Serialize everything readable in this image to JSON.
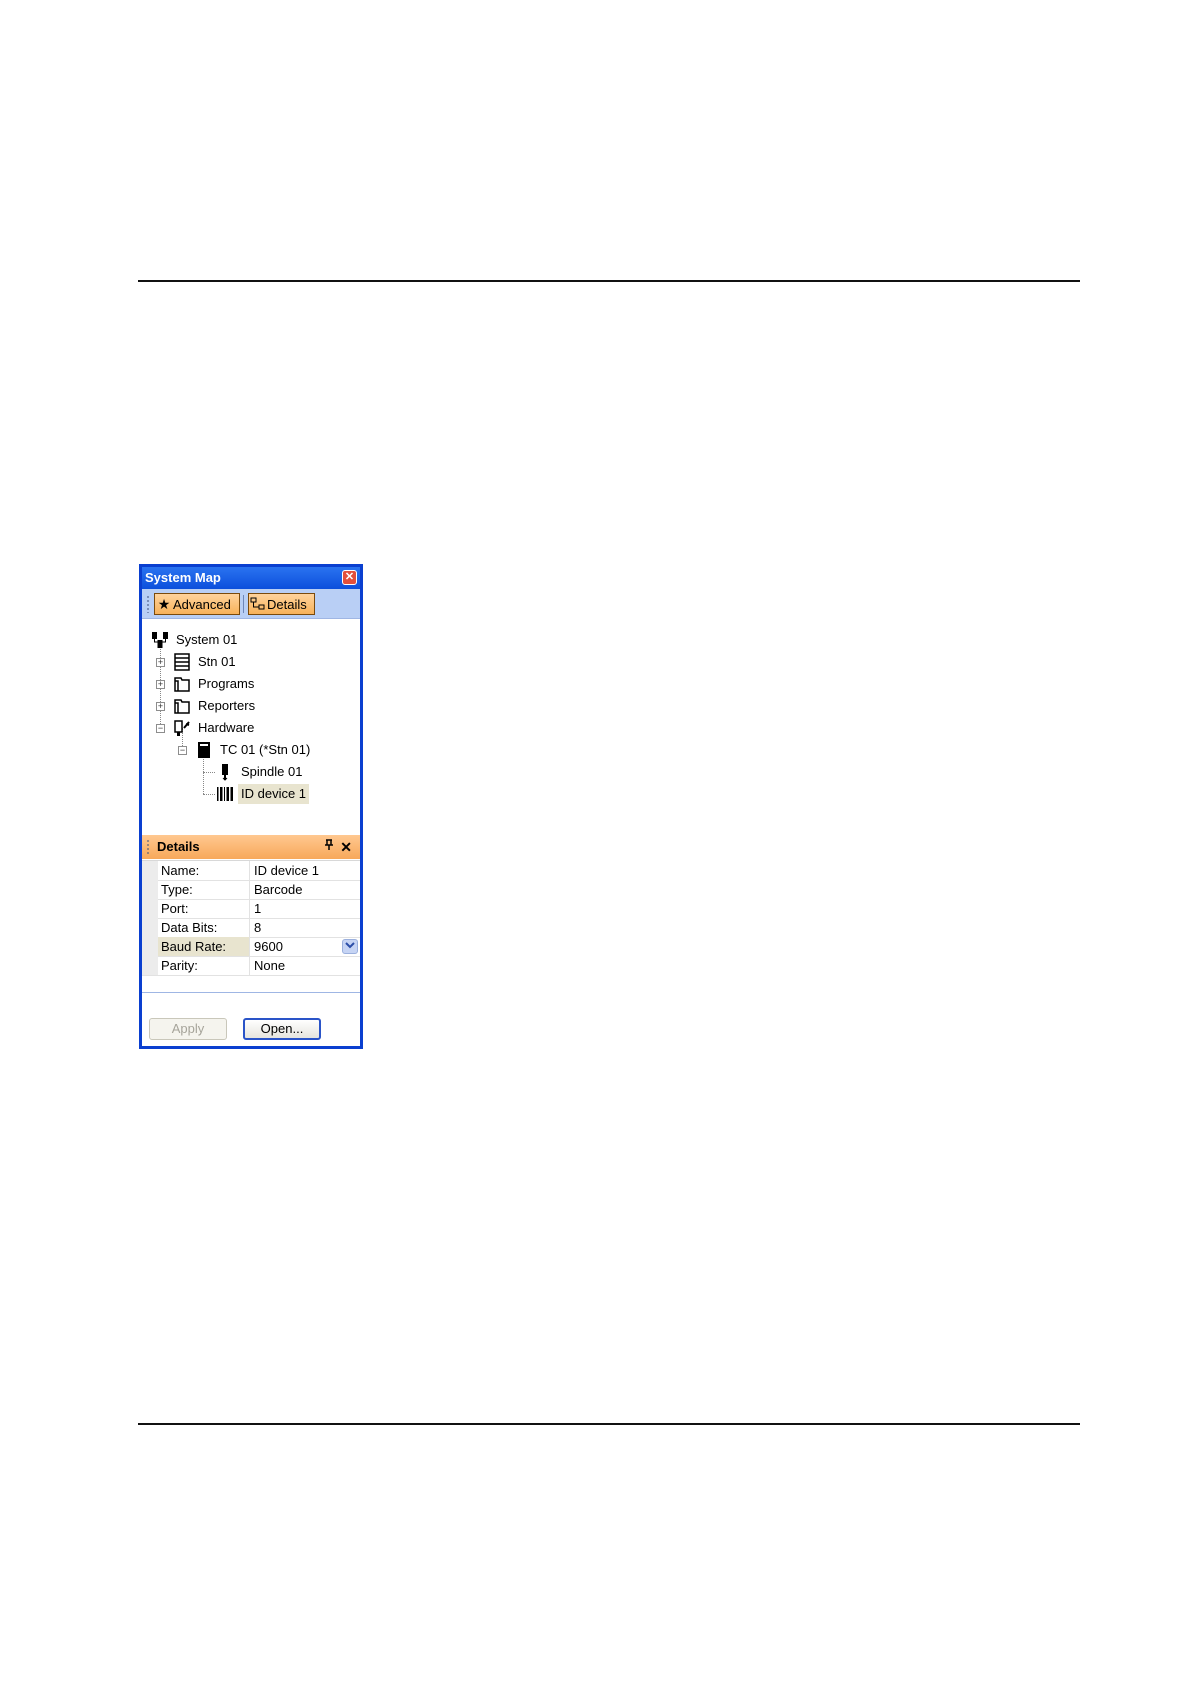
{
  "window": {
    "title": "System Map",
    "close_glyph": "✕"
  },
  "toolbar": {
    "advanced_label": "Advanced",
    "details_label": "Details",
    "advanced_icon": "star-icon",
    "details_icon": "details-tree-icon"
  },
  "tree": {
    "system": "System 01",
    "stn": "Stn 01",
    "programs": "Programs",
    "reporters": "Reporters",
    "hardware": "Hardware",
    "tc": "TC 01 (*Stn 01)",
    "spindle": "Spindle 01",
    "id_device": "ID device 1"
  },
  "details": {
    "title": "Details",
    "pin_glyph": "📌",
    "close_glyph": "✕",
    "rows": [
      {
        "key": "Name:",
        "value": "ID device 1"
      },
      {
        "key": "Type:",
        "value": "Barcode"
      },
      {
        "key": "Port:",
        "value": "1"
      },
      {
        "key": "Data Bits:",
        "value": "8"
      },
      {
        "key": "Baud Rate:",
        "value": "9600"
      },
      {
        "key": "Parity:",
        "value": "None"
      }
    ],
    "dropdown_glyph": "⌄"
  },
  "buttons": {
    "apply": "Apply",
    "open": "Open..."
  },
  "colors": {
    "window_border": "#0a3fd0",
    "titlebar": "#0c4fdc",
    "toolbar_bg": "#b9cff5",
    "button_orange": "#f7b25a",
    "details_header": "#f7a85a",
    "selection": "#e8e4cf"
  }
}
